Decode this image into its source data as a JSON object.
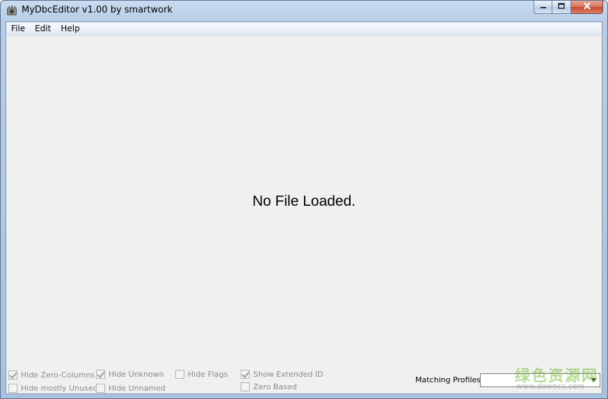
{
  "window": {
    "title": "MyDbcEditor v1.00 by smartwork",
    "icon": "app-gear-icon"
  },
  "caption_buttons": {
    "minimize_icon": "minimize-icon",
    "maximize_icon": "maximize-icon",
    "close_icon": "close-icon"
  },
  "menu": {
    "items": [
      {
        "label": "File"
      },
      {
        "label": "Edit"
      },
      {
        "label": "Help"
      }
    ]
  },
  "main": {
    "status_message": "No File Loaded."
  },
  "options": {
    "checkboxes": [
      {
        "label": "Hide Zero-Columns",
        "checked": true
      },
      {
        "label": "Hide mostly Unused",
        "checked": false
      },
      {
        "label": "Hide Unknown",
        "checked": true
      },
      {
        "label": "Hide Unnamed",
        "checked": false
      },
      {
        "label": "Hide Flags",
        "checked": false
      },
      {
        "label": "Show Extended ID",
        "checked": true
      },
      {
        "label": "Zero Based",
        "checked": false
      }
    ],
    "enabled": false
  },
  "profiles": {
    "label": "Matching Profiles:",
    "selected_value": ""
  },
  "watermark": {
    "main": "绿色资源网",
    "sub": "www.downcc.com"
  },
  "colors": {
    "client_background": "#f0f0f0",
    "disabled_text": "#8a8a8a",
    "close_button": "#c7472e"
  }
}
